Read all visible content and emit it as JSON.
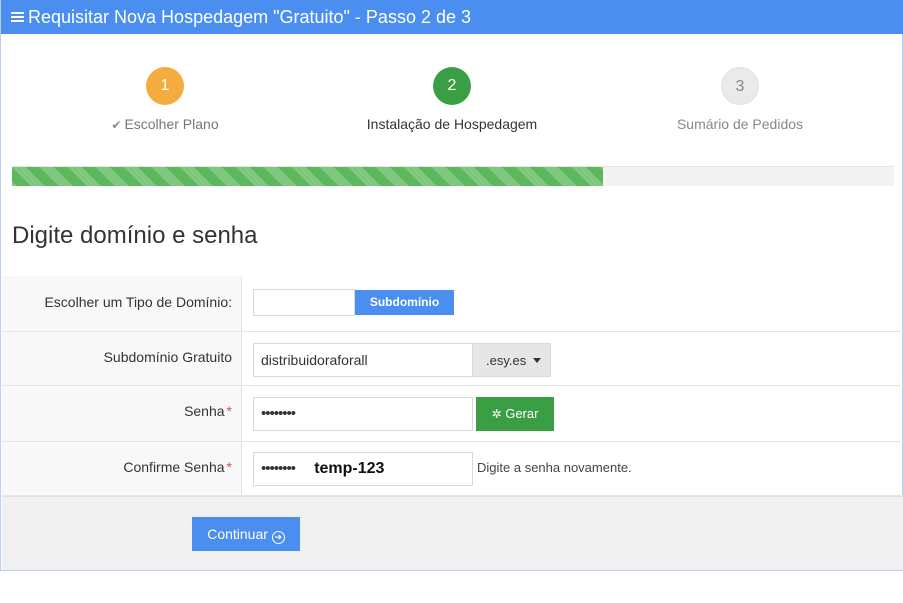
{
  "header": {
    "title": "Requisitar Nova Hospedagem \"Gratuito\" - Passo 2 de 3",
    "menu_icon": "menu-icon"
  },
  "steps": [
    {
      "number": "1",
      "label": "Escolher Plano",
      "state": "completed",
      "color": "#f5ac3e"
    },
    {
      "number": "2",
      "label": "Instalação de Hospedagem",
      "state": "active",
      "color": "#3a9e44"
    },
    {
      "number": "3",
      "label": "Sumário de Pedidos",
      "state": "pending",
      "color": "#eaeaea"
    }
  ],
  "progress": {
    "percent": 67,
    "color": "#5cb85c"
  },
  "section_title": "Digite domínio e senha",
  "form": {
    "domain_type": {
      "label": "Escolher um Tipo de Domínio:",
      "value": "",
      "button": "Subdomínio"
    },
    "subdomain": {
      "label": "Subdomínio Gratuito",
      "value": "distribuidoraforall",
      "suffix": ".esy.es"
    },
    "password": {
      "label": "Senha",
      "value": "••••••••",
      "generate_button": "Gerar"
    },
    "confirm": {
      "label": "Confirme Senha",
      "value": "••••••••",
      "overlay_text": "temp-123",
      "help": "Digite a senha novamente."
    },
    "required_marker": "*"
  },
  "footer": {
    "continue_label": "Continuar"
  },
  "colors": {
    "accent": "#4a8ff0",
    "success": "#3a9e44",
    "warning": "#f5ac3e",
    "required": "#d9534f"
  }
}
